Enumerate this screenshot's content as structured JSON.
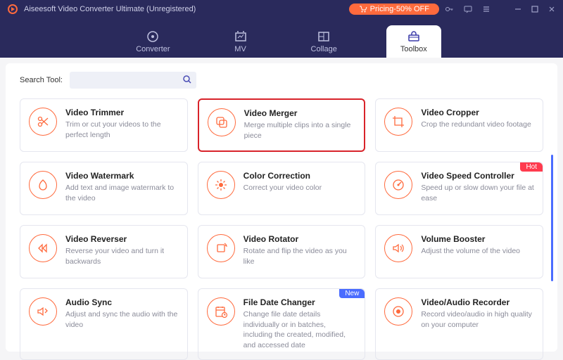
{
  "titlebar": {
    "app_title": "Aiseesoft Video Converter Ultimate (Unregistered)",
    "pricing_label": "Pricing-50% OFF"
  },
  "nav": {
    "tabs": [
      {
        "label": "Converter"
      },
      {
        "label": "MV"
      },
      {
        "label": "Collage"
      },
      {
        "label": "Toolbox"
      }
    ]
  },
  "search": {
    "label": "Search Tool:",
    "value": ""
  },
  "tools": [
    {
      "title": "Video Trimmer",
      "desc": "Trim or cut your videos to the perfect length",
      "icon": "scissors",
      "highlight": false
    },
    {
      "title": "Video Merger",
      "desc": "Merge multiple clips into a single piece",
      "icon": "merge",
      "highlight": true
    },
    {
      "title": "Video Cropper",
      "desc": "Crop the redundant video footage",
      "icon": "crop",
      "highlight": false
    },
    {
      "title": "Video Watermark",
      "desc": "Add text and image watermark to the video",
      "icon": "watermark",
      "highlight": false
    },
    {
      "title": "Color Correction",
      "desc": "Correct your video color",
      "icon": "color",
      "highlight": false
    },
    {
      "title": "Video Speed Controller",
      "desc": "Speed up or slow down your file at ease",
      "icon": "speed",
      "highlight": false,
      "badge": "Hot"
    },
    {
      "title": "Video Reverser",
      "desc": "Reverse your video and turn it backwards",
      "icon": "reverse",
      "highlight": false
    },
    {
      "title": "Video Rotator",
      "desc": "Rotate and flip the video as you like",
      "icon": "rotate",
      "highlight": false
    },
    {
      "title": "Volume Booster",
      "desc": "Adjust the volume of the video",
      "icon": "volume",
      "highlight": false
    },
    {
      "title": "Audio Sync",
      "desc": "Adjust and sync the audio with the video",
      "icon": "sync",
      "highlight": false
    },
    {
      "title": "File Date Changer",
      "desc": "Change file date details individually or in batches, including the created, modified, and accessed date",
      "icon": "date",
      "highlight": false,
      "badge": "New"
    },
    {
      "title": "Video/Audio Recorder",
      "desc": "Record video/audio in high quality on your computer",
      "icon": "record",
      "highlight": false
    }
  ]
}
